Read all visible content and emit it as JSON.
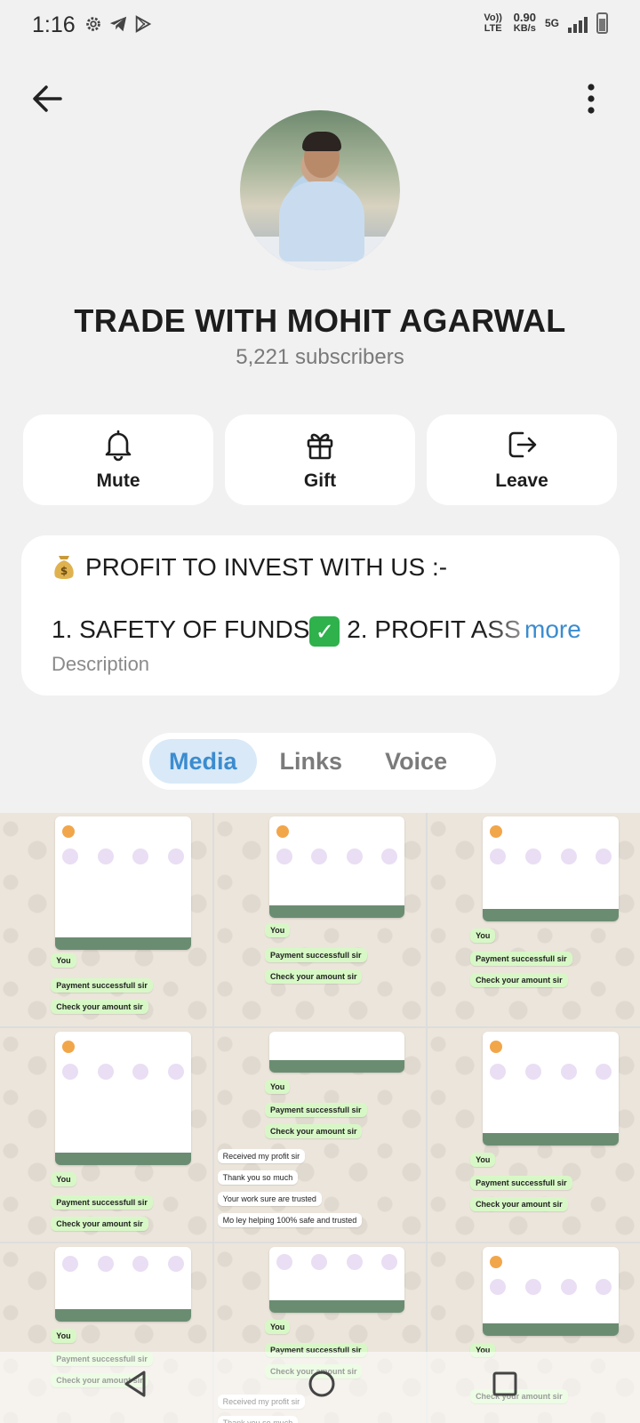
{
  "status_bar": {
    "time": "1:16",
    "network_label": "Vo)) LTE",
    "speed_value": "0.90",
    "speed_unit": "KB/s",
    "network_type": "5G"
  },
  "header": {
    "back_icon": "arrow-left-icon",
    "menu_icon": "more-vertical-icon"
  },
  "channel": {
    "title": "TRADE WITH MOHIT AGARWAL",
    "subscribers": "5,221 subscribers"
  },
  "actions": [
    {
      "label": "Mute",
      "icon": "bell-icon"
    },
    {
      "label": "Gift",
      "icon": "gift-icon"
    },
    {
      "label": "Leave",
      "icon": "leave-icon"
    }
  ],
  "description": {
    "line1": "PROFIT TO INVEST WITH US :-",
    "line2_a": "1. SAFETY OF FUNDS",
    "line2_b": " 2. PROFIT ASS",
    "more": "more",
    "label": "Description"
  },
  "tabs": [
    {
      "label": "Media",
      "active": true
    },
    {
      "label": "Links",
      "active": false
    },
    {
      "label": "Voice",
      "active": false
    }
  ],
  "media_grid": {
    "bubble_payment": "Payment successfull sir",
    "bubble_check": "Check your amount sir",
    "bubble_photo": "You",
    "msg_received": "Received my profit sir",
    "msg_thanks": "Thank you so much",
    "msg_trusted": "Your work sure are trusted",
    "msg_helping": "Mo ley helping 100% safe and trusted"
  },
  "colors": {
    "accent": "#3b8ccf",
    "background": "#f1f1f1",
    "card": "#ffffff",
    "active_tab_bg": "#d9e9f7"
  }
}
